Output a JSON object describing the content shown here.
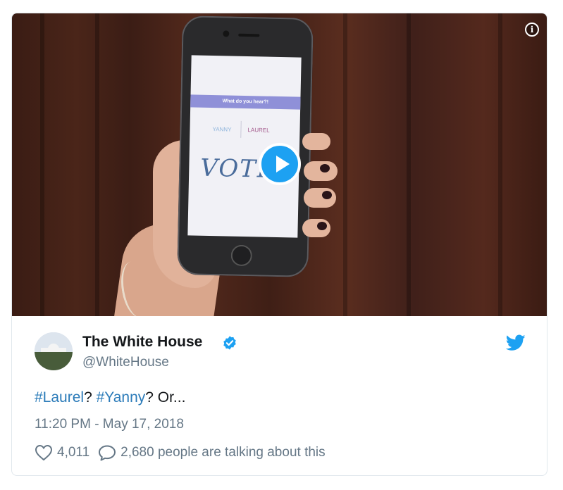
{
  "tweet": {
    "author_name": "The White House",
    "author_handle": "@WhiteHouse",
    "verified": true,
    "text_parts": {
      "hashtag1": "#Laurel",
      "sep1": "? ",
      "hashtag2": "#Yanny",
      "rest": "? Or..."
    },
    "timestamp": "11:20 PM - May 17, 2018",
    "likes": "4,011",
    "replies_text": "2,680 people are talking about this"
  },
  "video": {
    "screen_question": "What do you hear?!",
    "option_yanny": "YANNY",
    "option_laurel": "LAUREL",
    "handwritten_word": "VOTE"
  },
  "icons": {
    "play": "play-icon",
    "info": "info-icon",
    "verified": "verified-badge-icon",
    "twitter": "twitter-bird-icon",
    "like": "heart-icon",
    "reply": "speech-bubble-icon"
  },
  "colors": {
    "link": "#2b7bb9",
    "twitter_blue": "#1da1f2",
    "secondary_text": "#657786",
    "primary_text": "#14171a"
  }
}
